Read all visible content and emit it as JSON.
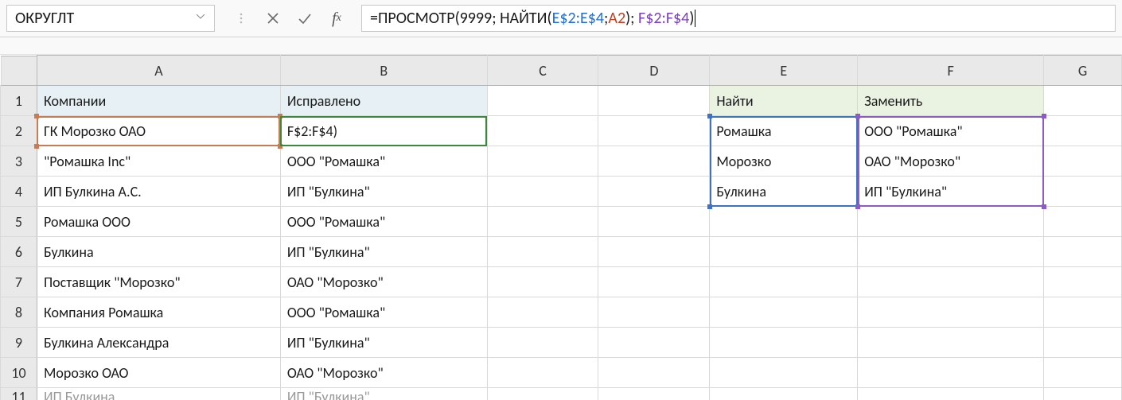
{
  "namebox": {
    "value": "ОКРУГЛТ"
  },
  "formula": {
    "parts": [
      {
        "text": "=ПРОСМОТР(9999; НАЙТИ(",
        "cls": "c-black"
      },
      {
        "text": "E$2:E$4",
        "cls": "c-blue"
      },
      {
        "text": ";",
        "cls": "c-black"
      },
      {
        "text": "A2",
        "cls": "c-red"
      },
      {
        "text": "); ",
        "cls": "c-black"
      },
      {
        "text": "F$2:F$4",
        "cls": "c-purple"
      },
      {
        "text": ")",
        "cls": "c-black"
      }
    ]
  },
  "columns": [
    "A",
    "B",
    "C",
    "D",
    "E",
    "F",
    "G"
  ],
  "rows": [
    "1",
    "2",
    "3",
    "4",
    "5",
    "6",
    "7",
    "8",
    "9",
    "10",
    "11"
  ],
  "cells": {
    "A1": "Компании",
    "B1": "Исправлено",
    "E1": "Найти",
    "F1": "Заменить",
    "A2": "ГК Морозко ОАО",
    "B2": "F$2:F$4)",
    "E2": "Ромашка",
    "F2": "ООО \"Ромашка\"",
    "A3": "\"Ромашка Inc\"",
    "B3": "ООО \"Ромашка\"",
    "E3": "Морозко",
    "F3": "ОАО \"Морозко\"",
    "A4": "ИП Булкина А.С.",
    "B4": "ИП \"Булкина\"",
    "E4": "Булкина",
    "F4": "ИП \"Булкина\"",
    "A5": "Ромашка ООО",
    "B5": "ООО \"Ромашка\"",
    "A6": "Булкина",
    "B6": "ИП \"Булкина\"",
    "A7": "Поставщик \"Морозко\"",
    "B7": "ОАО \"Морозко\"",
    "A8": "Компания Ромашка",
    "B8": "ООО \"Ромашка\"",
    "A9": "Булкина Александра",
    "B9": "ИП \"Булкина\"",
    "A10": "Морозко ОАО",
    "B10": "ОАО \"Морозко\"",
    "A11": "ИП Булкина",
    "B11": "ИП \"Булкина\""
  },
  "chart_data": {
    "type": "table",
    "tables": [
      {
        "name": "main",
        "columns": [
          "Компании",
          "Исправлено"
        ],
        "rows": [
          [
            "ГК Морозко ОАО",
            "F$2:F$4)"
          ],
          [
            "\"Ромашка Inc\"",
            "ООО \"Ромашка\""
          ],
          [
            "ИП Булкина А.С.",
            "ИП \"Булкина\""
          ],
          [
            "Ромашка ООО",
            "ООО \"Ромашка\""
          ],
          [
            "Булкина",
            "ИП \"Булкина\""
          ],
          [
            "Поставщик \"Морозко\"",
            "ОАО \"Морозко\""
          ],
          [
            "Компания Ромашка",
            "ООО \"Ромашка\""
          ],
          [
            "Булкина Александра",
            "ИП \"Булкина\""
          ],
          [
            "Морозко ОАО",
            "ОАО \"Морозко\""
          ],
          [
            "ИП Булкина",
            "ИП \"Булкина\""
          ]
        ]
      },
      {
        "name": "lookup",
        "columns": [
          "Найти",
          "Заменить"
        ],
        "rows": [
          [
            "Ромашка",
            "ООО \"Ромашка\""
          ],
          [
            "Морозко",
            "ОАО \"Морозко\""
          ],
          [
            "Булкина",
            "ИП \"Булкина\""
          ]
        ]
      }
    ]
  }
}
